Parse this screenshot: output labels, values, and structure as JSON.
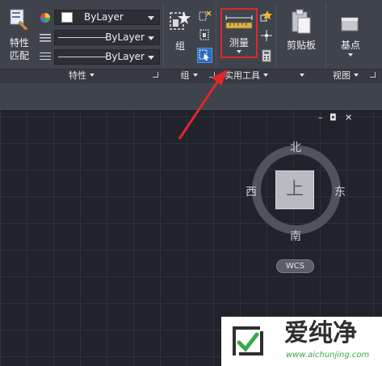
{
  "properties": {
    "match_label_line1": "特性",
    "match_label_line2": "匹配",
    "color_value": "ByLayer",
    "linetype_value": "ByLayer",
    "lineweight_value": "ByLayer",
    "panel_title": "特性"
  },
  "group": {
    "group_label": "组",
    "panel_title": "组"
  },
  "utilities": {
    "measure_label": "测量",
    "panel_title": "实用工具"
  },
  "clipboard": {
    "paste_label": "剪贴板"
  },
  "view": {
    "basepoint_label": "基点",
    "panel_title": "视图"
  },
  "viewport": {
    "window_controls": {
      "minimize": "–",
      "restore": "◘",
      "close": "✕"
    },
    "viewcube": {
      "north": "北",
      "south": "南",
      "east": "东",
      "west": "西",
      "face": "上",
      "wcs": "WCS"
    }
  },
  "watermark": {
    "title": "爱纯净",
    "url": "www.aichunjing.com"
  },
  "colors": {
    "highlight_box": "#e2262a",
    "ribbon_bg": "#3f434c",
    "canvas_bg": "#21232c"
  }
}
